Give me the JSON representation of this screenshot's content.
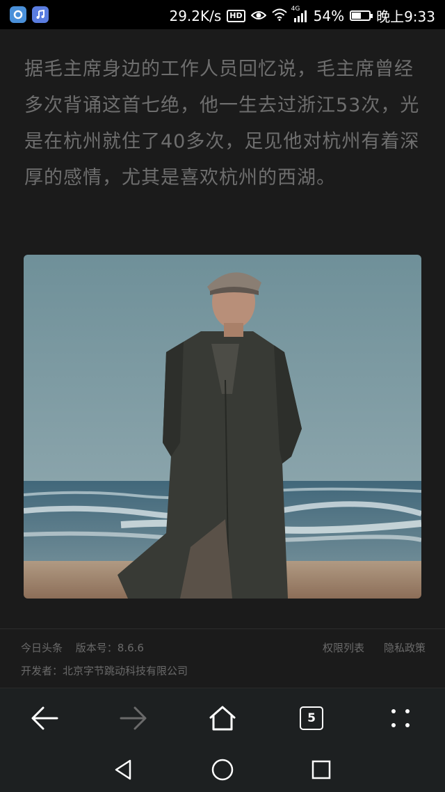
{
  "status_bar": {
    "speed": "29.2K/s",
    "hd": "HD",
    "network": "4G",
    "battery_percent": "54%",
    "battery_level": 0.54,
    "time": "晚上9:33",
    "icons": [
      "notification-app-icon",
      "music-app-icon",
      "eye-icon",
      "wifi-icon",
      "signal-icon",
      "battery-icon"
    ]
  },
  "article": {
    "paragraph": "据毛主席身边的工作人员回忆说，毛主席曾经多次背诵这首七绝，他一生去过浙江53次，光是在杭州就住了40多次，足见他对杭州有着深厚的感情，尤其是喜欢杭州的西湖。"
  },
  "footer": {
    "app_name": "今日头条",
    "version": "版本号：8.6.6",
    "developer": "开发者：北京字节跳动科技有限公司",
    "permissions": "权限列表",
    "privacy": "隐私政策"
  },
  "browser_nav": {
    "tab_count": "5",
    "icons": [
      "back-arrow-icon",
      "forward-arrow-icon",
      "home-icon",
      "tabs-icon",
      "menu-dots-icon"
    ]
  },
  "system_nav": {
    "icons": [
      "back-triangle-icon",
      "home-circle-icon",
      "recents-square-icon"
    ]
  },
  "colors": {
    "background": "#1b1b1b",
    "text": "#6e6e6e",
    "nav_bg": "#1d2021"
  }
}
